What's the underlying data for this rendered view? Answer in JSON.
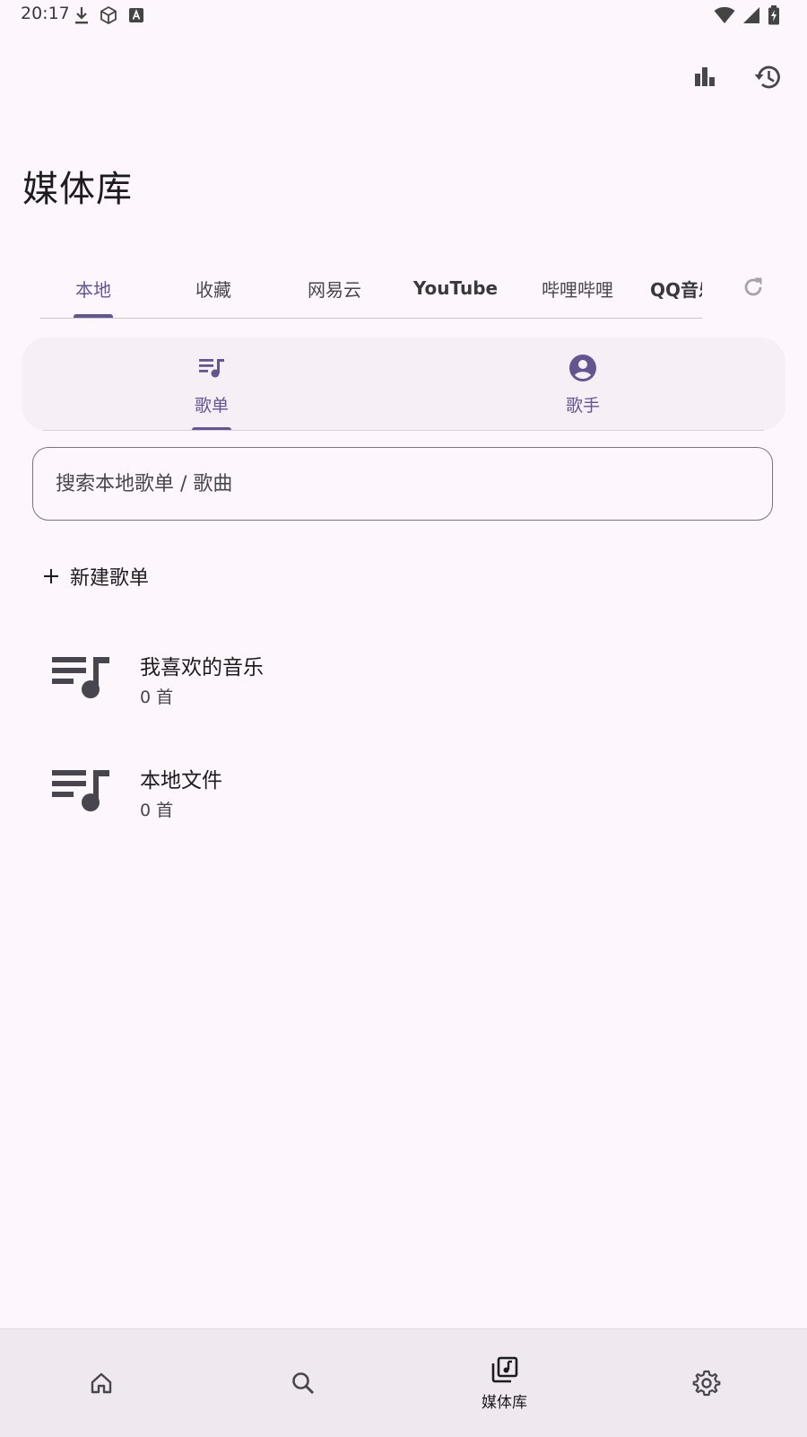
{
  "status_bar": {
    "time": "20:17"
  },
  "header": {
    "title": "媒体库"
  },
  "source_tabs": [
    {
      "label": "本地"
    },
    {
      "label": "收藏"
    },
    {
      "label": "网易云"
    },
    {
      "label": "YouTube"
    },
    {
      "label": "哔哩哔哩"
    },
    {
      "label": "QQ音乐"
    }
  ],
  "sub_tabs": [
    {
      "label": "歌单"
    },
    {
      "label": "歌手"
    }
  ],
  "search": {
    "placeholder": "搜索本地歌单 / 歌曲"
  },
  "new_playlist": {
    "label": "新建歌单"
  },
  "playlists": [
    {
      "name": "我喜欢的音乐",
      "count": "0 首"
    },
    {
      "name": "本地文件",
      "count": "0 首"
    }
  ],
  "bottom_nav": {
    "library_label": "媒体库"
  },
  "colors": {
    "accent": "#65558F",
    "background": "#FDF7FD",
    "nav_bg": "#EFE8EF"
  }
}
